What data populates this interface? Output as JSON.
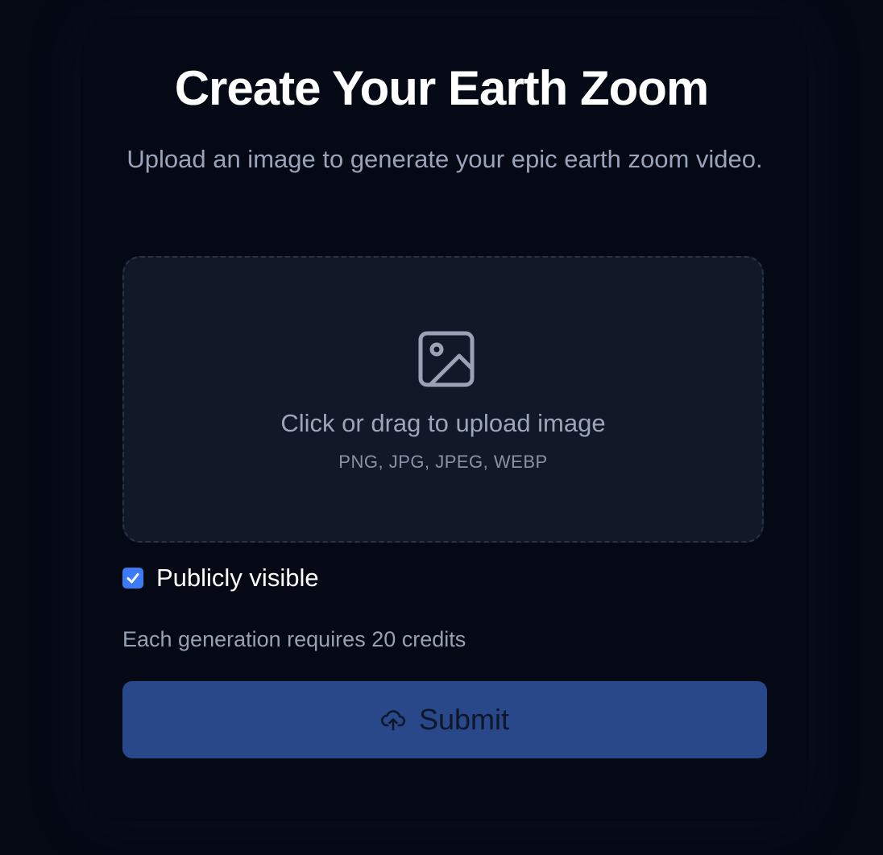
{
  "header": {
    "title": "Create Your Earth Zoom",
    "subtitle": "Upload an image to generate your epic earth zoom video."
  },
  "upload": {
    "icon": "image-icon",
    "label": "Click or drag to upload image",
    "formats": "PNG, JPG, JPEG, WEBP"
  },
  "visibility": {
    "checked": true,
    "label": "Publicly visible"
  },
  "credits_note": "Each generation requires 20 credits",
  "submit": {
    "icon": "cloud-upload-icon",
    "label": "Submit"
  },
  "colors": {
    "background": "#050914",
    "accent": "#3b7bf6",
    "button": "#28488a"
  }
}
